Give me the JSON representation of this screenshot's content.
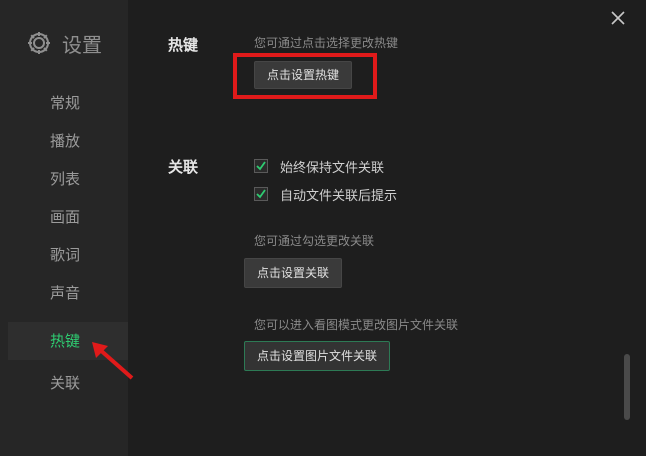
{
  "sidebar": {
    "title": "设置",
    "icon": "gear-icon",
    "items": [
      {
        "label": "常规",
        "active": false
      },
      {
        "label": "播放",
        "active": false
      },
      {
        "label": "列表",
        "active": false
      },
      {
        "label": "画面",
        "active": false
      },
      {
        "label": "歌词",
        "active": false
      },
      {
        "label": "声音",
        "active": false
      },
      {
        "label": "热键",
        "active": true
      },
      {
        "label": "关联",
        "active": false
      }
    ]
  },
  "hotkey": {
    "label": "热键",
    "hint": "您可通过点击选择更改热键",
    "button": "点击设置热键"
  },
  "association": {
    "label": "关联",
    "options": [
      {
        "label": "始终保持文件关联",
        "checked": true
      },
      {
        "label": "自动文件关联后提示",
        "checked": true
      }
    ],
    "hint1": "您可通过勾选更改关联",
    "button1": "点击设置关联",
    "hint2": "您可以进入看图模式更改图片文件关联",
    "button2": "点击设置图片文件关联"
  },
  "colors": {
    "background": "#1e1e1e",
    "sidebar": "#262626",
    "accent": "#2ecc71",
    "highlight": "#e01a1a"
  }
}
